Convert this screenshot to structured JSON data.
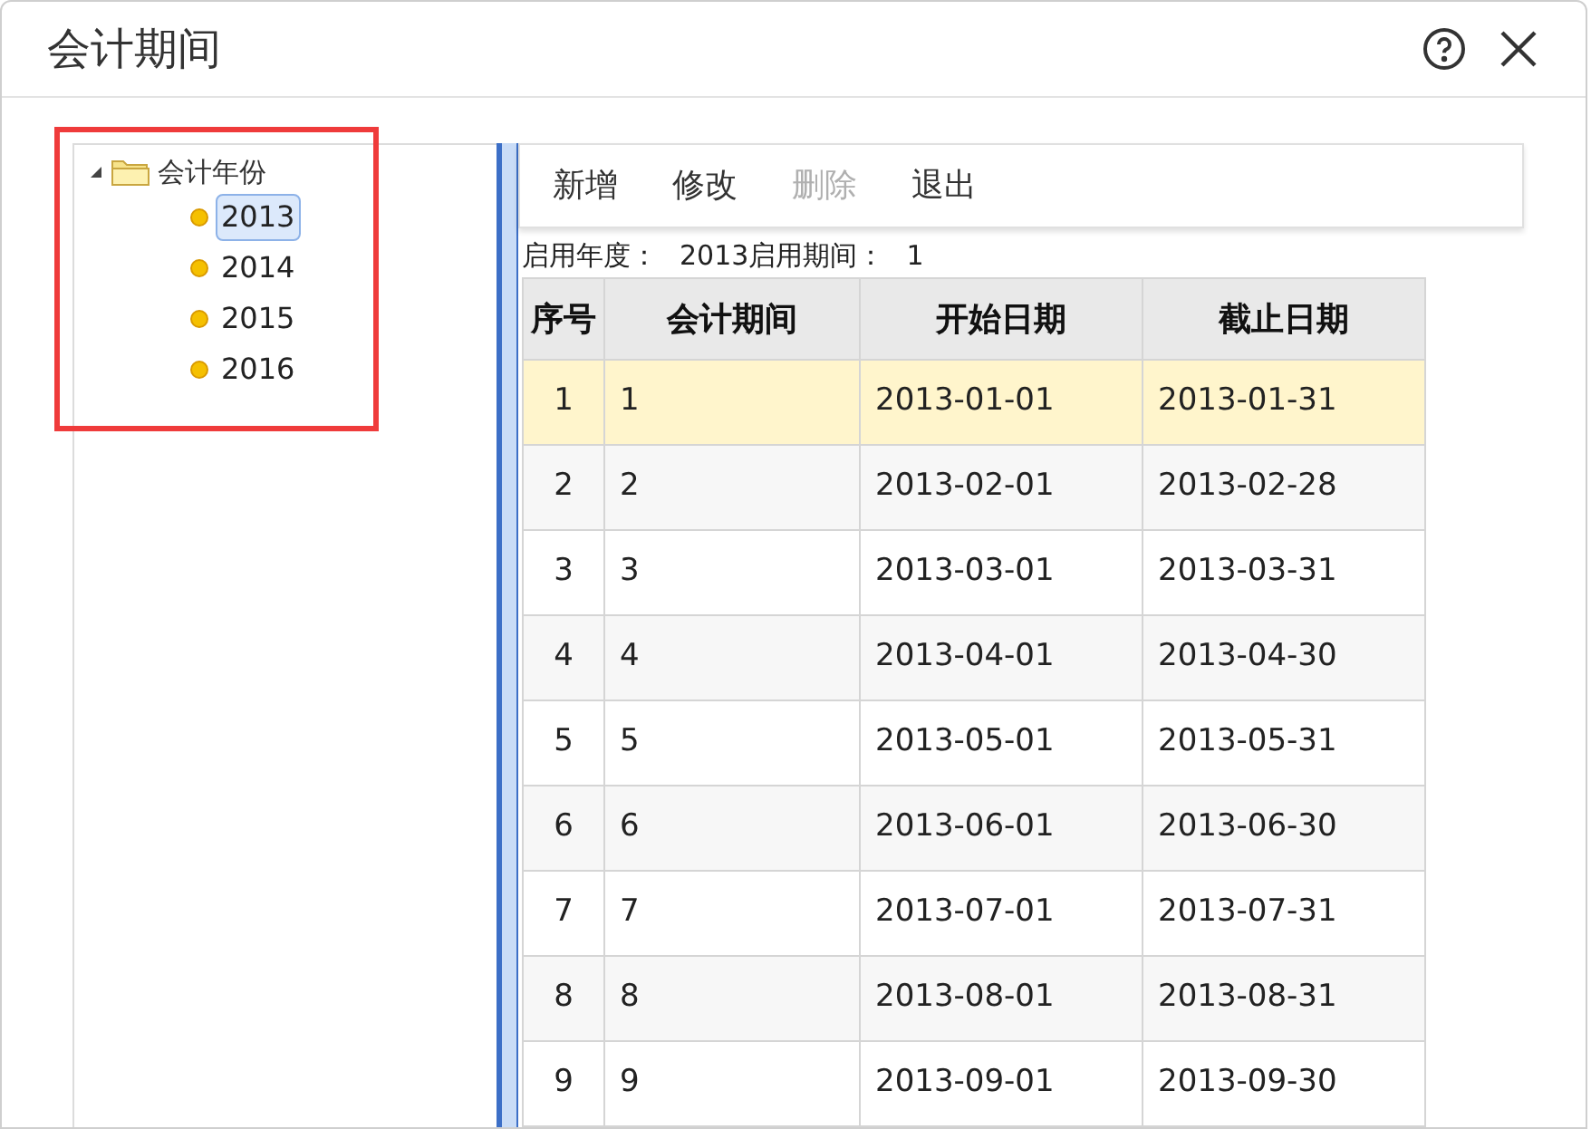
{
  "window": {
    "title": "会计期间"
  },
  "tree": {
    "label": "会计年份",
    "expanded": true,
    "children": [
      {
        "label": "2013",
        "selected": true
      },
      {
        "label": "2014",
        "selected": false
      },
      {
        "label": "2015",
        "selected": false
      },
      {
        "label": "2016",
        "selected": false
      }
    ]
  },
  "toolbar": [
    {
      "label": "新增",
      "disabled": false
    },
    {
      "label": "修改",
      "disabled": false
    },
    {
      "label": "删除",
      "disabled": true
    },
    {
      "label": "退出",
      "disabled": false
    }
  ],
  "info": [
    {
      "label": "启用年度：",
      "value": "2013"
    },
    {
      "label": "启用期间：",
      "value": "1"
    }
  ],
  "table": {
    "columns": [
      "序号",
      "会计期间",
      "开始日期",
      "截止日期"
    ],
    "rows": [
      {
        "cells": [
          "1",
          "1",
          "2013-01-01",
          "2013-01-31"
        ],
        "selected": true
      },
      {
        "cells": [
          "2",
          "2",
          "2013-02-01",
          "2013-02-28"
        ],
        "selected": false
      },
      {
        "cells": [
          "3",
          "3",
          "2013-03-01",
          "2013-03-31"
        ],
        "selected": false
      },
      {
        "cells": [
          "4",
          "4",
          "2013-04-01",
          "2013-04-30"
        ],
        "selected": false
      },
      {
        "cells": [
          "5",
          "5",
          "2013-05-01",
          "2013-05-31"
        ],
        "selected": false
      },
      {
        "cells": [
          "6",
          "6",
          "2013-06-01",
          "2013-06-30"
        ],
        "selected": false
      },
      {
        "cells": [
          "7",
          "7",
          "2013-07-01",
          "2013-07-31"
        ],
        "selected": false
      },
      {
        "cells": [
          "8",
          "8",
          "2013-08-01",
          "2013-08-31"
        ],
        "selected": false
      },
      {
        "cells": [
          "9",
          "9",
          "2013-09-01",
          "2013-09-30"
        ],
        "selected": false
      }
    ]
  }
}
